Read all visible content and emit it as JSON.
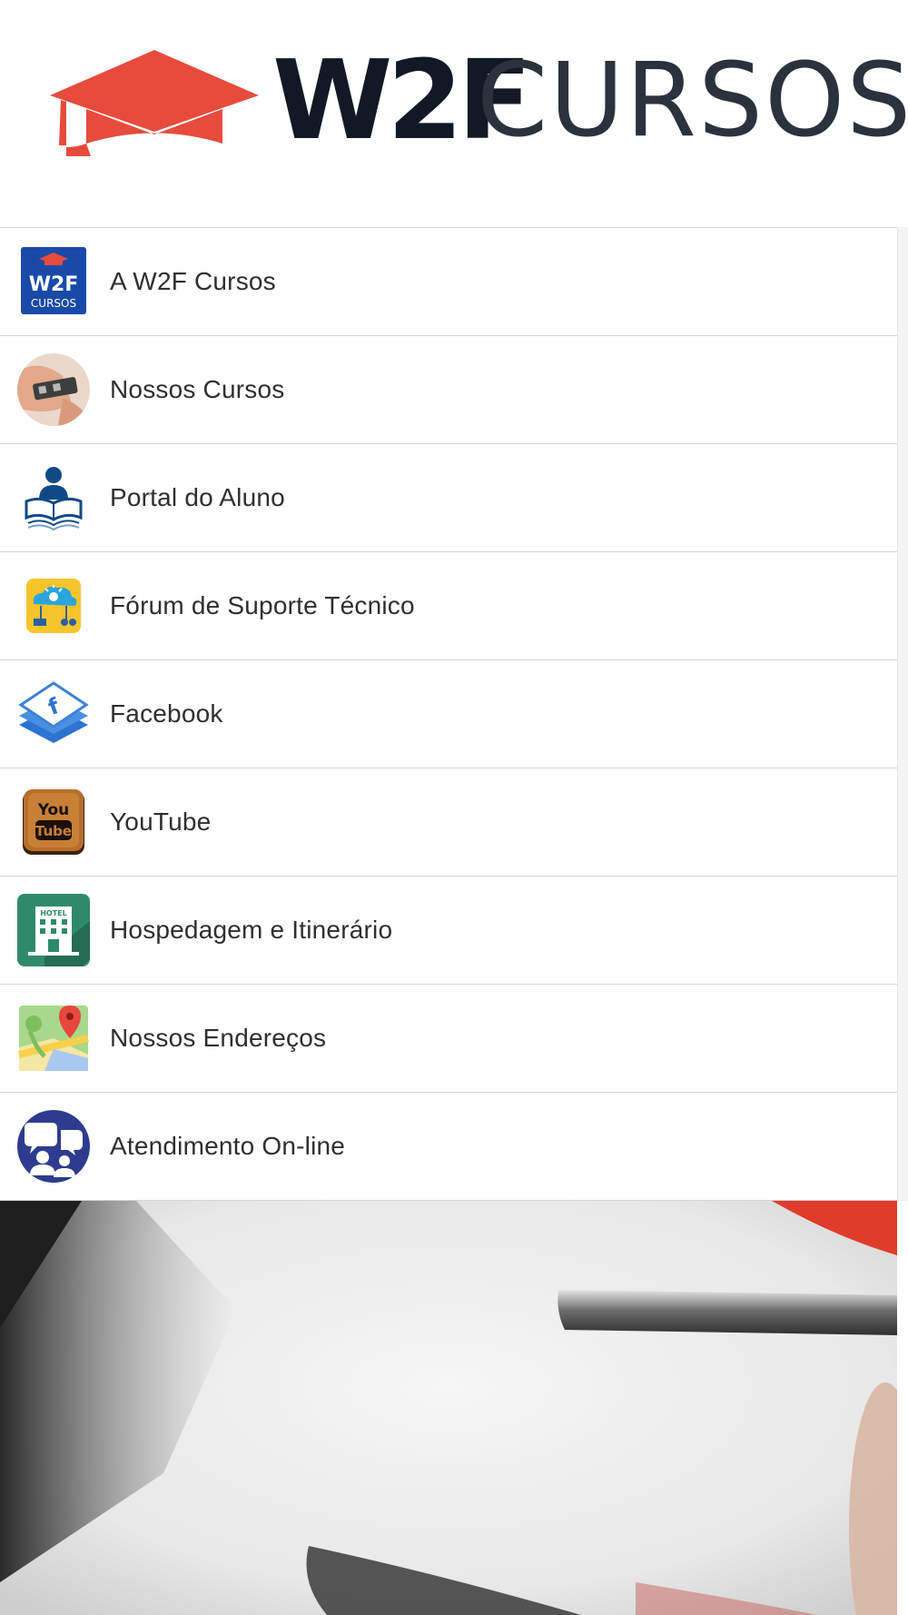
{
  "header": {
    "logo": {
      "brand_bold": "W2F",
      "brand_light": "CURSOS",
      "icon": "graduation-cap-icon",
      "colors": {
        "cap": "#e64b3c",
        "bold_text": "#111a24",
        "light_text": "#2a323c"
      }
    }
  },
  "menu": {
    "items": [
      {
        "label": "A W2F Cursos",
        "icon": "w2f-logo-icon"
      },
      {
        "label": "Nossos Cursos",
        "icon": "device-in-hand-icon"
      },
      {
        "label": "Portal do Aluno",
        "icon": "student-reading-icon"
      },
      {
        "label": "Fórum de Suporte Técnico",
        "icon": "cloud-idea-icon"
      },
      {
        "label": "Facebook",
        "icon": "facebook-icon"
      },
      {
        "label": "YouTube",
        "icon": "youtube-icon"
      },
      {
        "label": "Hospedagem e Itinerário",
        "icon": "hotel-icon"
      },
      {
        "label": "Nossos Endereços",
        "icon": "map-pin-icon"
      },
      {
        "label": "Atendimento On-line",
        "icon": "chat-support-icon"
      }
    ]
  },
  "icon_texts": {
    "w2f_top": "W2F",
    "w2f_bottom": "CURSOS",
    "youtube_top": "You",
    "youtube_bottom": "Tube",
    "hotel": "HOTEL",
    "facebook": "f"
  },
  "banner": {
    "image": "screwdriver-photo"
  }
}
